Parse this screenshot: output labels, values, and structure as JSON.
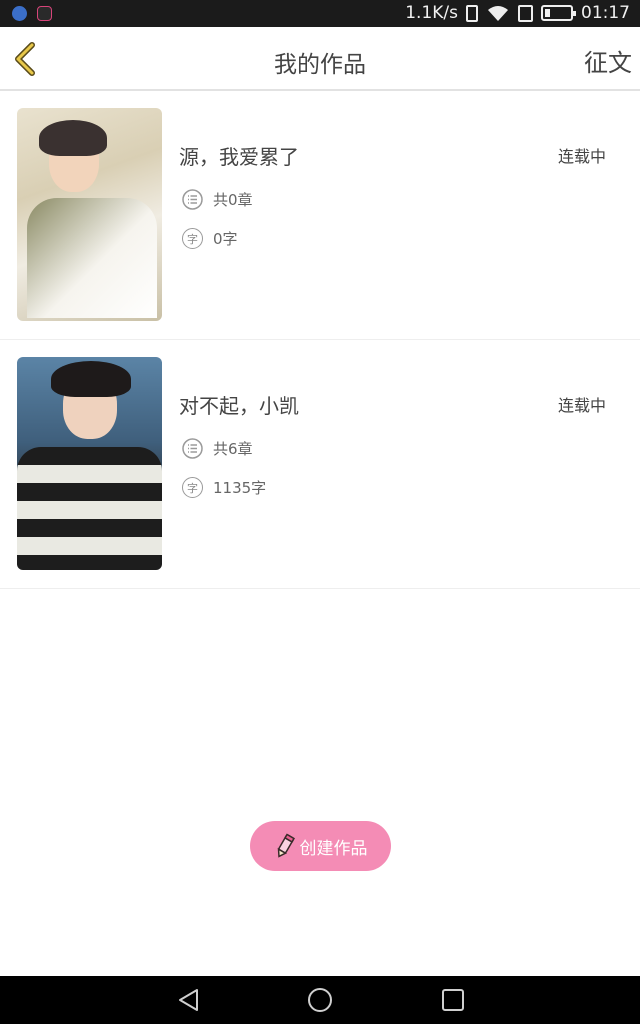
{
  "status_bar": {
    "network_speed": "1.1K/s",
    "time": "01:17",
    "battery_level": 0.2
  },
  "header": {
    "title": "我的作品",
    "action": "征文",
    "back_icon": "chevron-left-icon",
    "accent": "#e8c84a"
  },
  "works": [
    {
      "title": "源，我爱累了",
      "status": "连载中",
      "chapters": "共0章",
      "words": "0字"
    },
    {
      "title": "对不起，小凯",
      "status": "连载中",
      "chapters": "共6章",
      "words": "1135字"
    }
  ],
  "icons": {
    "chapters": "list-icon",
    "words": "character-icon",
    "words_glyph": "字"
  },
  "create_button": {
    "label": "创建作品",
    "color": "#f48cb5"
  },
  "nav_bar": {
    "back": "triangle-back-icon",
    "home": "circle-home-icon",
    "recent": "square-recent-icon"
  }
}
